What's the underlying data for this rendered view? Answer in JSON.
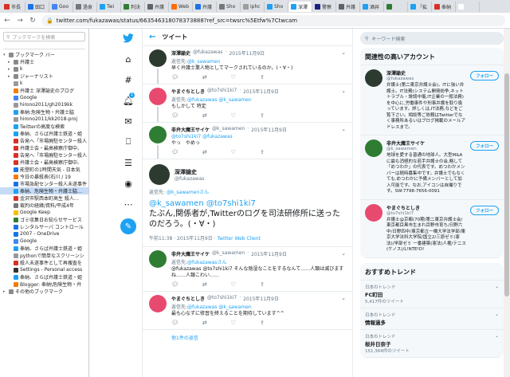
{
  "browser": {
    "tabs": [
      {
        "label": "市長",
        "color": "#d93025"
      },
      {
        "label": "田口",
        "color": "#1a73e8"
      },
      {
        "label": "Goo",
        "color": "#4285f4"
      },
      {
        "label": "過食",
        "color": "#777777"
      },
      {
        "label": "Twi",
        "color": "#1da1f2"
      },
      {
        "label": "判決",
        "color": "#2e7d32"
      },
      {
        "label": "弁護",
        "color": "#5f6368"
      },
      {
        "label": "Web",
        "color": "#ff6d00"
      },
      {
        "label": "弁護",
        "color": "#1a73e8"
      },
      {
        "label": "Sho",
        "color": "#777777"
      },
      {
        "label": "iphc",
        "color": "#9e9e9e"
      },
      {
        "label": "Sho",
        "color": "#1da1f2"
      },
      {
        "label": "深澤",
        "color": "#1da1f2"
      },
      {
        "label": "警察",
        "color": "#1a237e"
      },
      {
        "label": "弁護",
        "color": "#5f6368"
      },
      {
        "label": "酒井",
        "color": "#1da1f2"
      },
      {
        "label": "",
        "color": "#2e7d32"
      },
      {
        "label": "「拡",
        "color": "#1da1f2"
      },
      {
        "label": "奉納",
        "color": "#d93025"
      },
      {
        "label": "",
        "color": "#ffffff"
      }
    ],
    "url": "twitter.com/fukazawas/status/663546318078373888?ref_src=twsrc%5Etfw%7Ctwcam"
  },
  "bookmarks": {
    "search_placeholder": "ブックマークを検索",
    "items": [
      {
        "label": "ブックマーク バー",
        "depth": 0,
        "folder": true,
        "color": "#777"
      },
      {
        "label": "弁護士",
        "depth": 1,
        "folder": true,
        "color": "#777"
      },
      {
        "label": "k",
        "depth": 1,
        "folder": true,
        "color": "#777"
      },
      {
        "label": "ジャーナリスト",
        "depth": 1,
        "folder": true,
        "color": "#777"
      },
      {
        "label": "k",
        "depth": 1,
        "folder": false,
        "color": "#999"
      },
      {
        "label": "弁護士 深澤諭史のブログ",
        "depth": 1,
        "folder": false,
        "color": "#f57c00"
      },
      {
        "label": "Google",
        "depth": 1,
        "folder": false,
        "color": "#4285f4"
      },
      {
        "label": "hirono2011/gh2019kk",
        "depth": 1,
        "folder": false,
        "color": "#999"
      },
      {
        "label": "奉納:危険生物・弁護士脇",
        "depth": 1,
        "folder": false,
        "color": "#1da1f2"
      },
      {
        "label": "hirono2011/kk2018-proj",
        "depth": 1,
        "folder": false,
        "color": "#999"
      },
      {
        "label": "Twitterの高度な検索",
        "depth": 1,
        "folder": false,
        "color": "#1da1f2"
      },
      {
        "label": "奉納、さらば弁護士鉄道・姫",
        "depth": 1,
        "folder": false,
        "color": "#1da1f2"
      },
      {
        "label": "告発へ「市場廃駐センター殺人",
        "depth": 1,
        "folder": false,
        "color": "#d93025"
      },
      {
        "label": "弁護士会・最高検察庁御中、",
        "depth": 1,
        "folder": false,
        "color": "#d93025"
      },
      {
        "label": "告発へ「市場廃駐センター殺人",
        "depth": 1,
        "folder": false,
        "color": "#d93025"
      },
      {
        "label": "弁護士会・最高検察庁御中、",
        "depth": 1,
        "folder": false,
        "color": "#d93025"
      },
      {
        "label": "能登町の1時間天気 - 日本気",
        "depth": 1,
        "folder": false,
        "color": "#1a73e8"
      },
      {
        "label": "今日の暴殺表(石川 / 19",
        "depth": 1,
        "folder": false,
        "color": "#f57c00"
      },
      {
        "label": "市場急配センター殺人未遂事件",
        "depth": 1,
        "folder": false,
        "color": "#1a73e8"
      },
      {
        "label": "奉納、危険生物・弁護士脇…",
        "depth": 1,
        "folder": false,
        "color": "#1da1f2",
        "selected": true
      },
      {
        "label": "金沢市駅西本町高生 殺人…",
        "depth": 1,
        "folder": false,
        "color": "#d93025"
      },
      {
        "label": "裁判の経緯/資料/平成4年",
        "depth": 1,
        "folder": false,
        "color": "#777"
      },
      {
        "label": "Google Keep",
        "depth": 1,
        "folder": false,
        "color": "#fbbc04"
      },
      {
        "label": "ゴミ収集日お知らせサービス",
        "depth": 1,
        "folder": false,
        "color": "#2e7d32"
      },
      {
        "label": "レンタルサーバ コントロール",
        "depth": 1,
        "folder": false,
        "color": "#1a73e8"
      },
      {
        "label": "2007 - OneDrive",
        "depth": 1,
        "folder": false,
        "color": "#1a73e8"
      },
      {
        "label": "Google",
        "depth": 1,
        "folder": false,
        "color": "#4285f4"
      },
      {
        "label": "奉納、さらば弁護士鉄道・姫",
        "depth": 1,
        "folder": false,
        "color": "#1da1f2"
      },
      {
        "label": "pythonで簡単なスクリーンシ",
        "depth": 1,
        "folder": false,
        "color": "#999"
      },
      {
        "label": "殺人未遂事件として再捜査を",
        "depth": 1,
        "folder": false,
        "color": "#d93025"
      },
      {
        "label": "Settings - Personal access",
        "depth": 1,
        "folder": false,
        "color": "#333"
      },
      {
        "label": "奉納、さらば弁護士鉄道・姫",
        "depth": 1,
        "folder": false,
        "color": "#1da1f2"
      },
      {
        "label": "Blogger: 奉納\\危険生物・弁",
        "depth": 1,
        "folder": false,
        "color": "#f57c00"
      },
      {
        "label": "その他のブックマーク",
        "depth": 0,
        "folder": true,
        "color": "#777"
      }
    ]
  },
  "header": {
    "title": "ツイート",
    "back_icon": "arrow-left-icon"
  },
  "tweets_above": [
    {
      "name": "深澤諭史",
      "handle": "@fukazawas",
      "time": "2015年11月9日",
      "reply_prefix": "返信先:",
      "reply_to": "@k_sawamen",
      "text": "早く弁護士業人物としてマークされているのか。(・∀・)",
      "avatar": "#2d3a2f",
      "thread": true
    },
    {
      "name": "やまぐちとしき",
      "handle": "@to7shi1ki7",
      "time": "2015年11月9日",
      "reply_prefix": "返信先:",
      "reply_to": "@fukazawas @k_sawamen",
      "text": "もしかして 特定",
      "avatar": "#e84a6f",
      "thread": true
    },
    {
      "name": "非弁大魔王サイケ",
      "handle": "@k_sawamen",
      "time": "2015年11月9日",
      "reply_prefix": "",
      "reply_to": "@to7shi1ki7 @fukazawas",
      "text": "やっ　やめっ",
      "avatar": "#2e7d32",
      "thread": true
    }
  ],
  "focused": {
    "name": "深澤諭史",
    "handle": "@fukazawas",
    "reply_prefix": "返信先:",
    "reply_to": "@k_sawamenさん",
    "mention": "@k_sawamen @to7shi1ki7",
    "text": "たぶん,関係者が,Twitterのログを司法研修所に送ったのだろう。(・∀・)",
    "time": "午前11:38 · 2015年11月9日 · ",
    "client": "Twitter Web Client"
  },
  "replies": [
    {
      "name": "非弁大魔王サイケ",
      "handle": "@k_sawamen",
      "time": "2015年11月9日",
      "reply_prefix": "返信先:",
      "reply_to": "@fukazawasさん",
      "text": "@fukazawas @to7shi1ki7 そんな陰湿なことをするなんて……人類は滅びますね……人類こわい……",
      "avatar": "#2e7d32"
    },
    {
      "name": "やまぐちとしき",
      "handle": "@to7shi1ki7",
      "time": "2015年11月9日",
      "reply_prefix": "返信先:",
      "reply_to": "@fukazawas @k_sawamen",
      "text": "最も心なずに修習を終えることを期待しています^^",
      "avatar": "#e84a6f"
    }
  ],
  "more_replies": "他1件の返信",
  "right": {
    "search_placeholder": "キーワード検索",
    "related_title": "関連性の高いアカウント",
    "follow_label": "フォロー",
    "accounts": [
      {
        "name": "深澤諭史",
        "handle": "@fukazawas",
        "bio": "弁護士(第二東京弁護士会)。ITに強い弁護士。IT法務(システム開発紛争,ネットトラブル・誹謗中傷,IT企業の一般法務)を中心に,労働事件や刑事弁護を取り扱っています。詳しくは,IT法務,などをご覧下さい。相談等ご依頼はTwitterでなく事務所あるいはブログ掲載のメールアドレスまで。",
        "avatar": "#2d3a2f"
      },
      {
        "name": "非弁大魔王サイケ",
        "handle": "@k_sawamen",
        "bio": "地球を愛する普通の地球人。大型M&Aに最も消極的な若手弁護士の会,略して「めつわか」の代表です。めつわかメンバーは随時募集中です。弁護士でもなくても,めつわかに予備メンバーとして加入可能です。なお,アイコンは自撮りです。SW:7798-7656-0091",
        "avatar": "#2e7d32"
      },
      {
        "name": "やまぐちとしき",
        "handle": "@to7shi1ki7",
        "bio": "弁護士@京都(70期/第二東京弁護士会/東京都目黒市生まれ目野市育ち/日野六中/日野四中/東京都立一橋大学法学部/東京大学法科大学院/国立2/三原ゼミ(憲法)/学部ゼミ 一番建築(憲法)人権/テニス(ケノス)/L!NTE!D!",
        "avatar": "#e84a6f"
      }
    ],
    "trends_title": "おすすめトレンド",
    "trends": [
      {
        "context": "日本のトレンド",
        "name": "FC町田",
        "count": "5,417件のツイート"
      },
      {
        "context": "日本のトレンド",
        "name": "情報過多",
        "count": ""
      },
      {
        "context": "日本のトレンド",
        "name": "桜井日奈子",
        "count": "151,364件のツイート"
      }
    ]
  }
}
